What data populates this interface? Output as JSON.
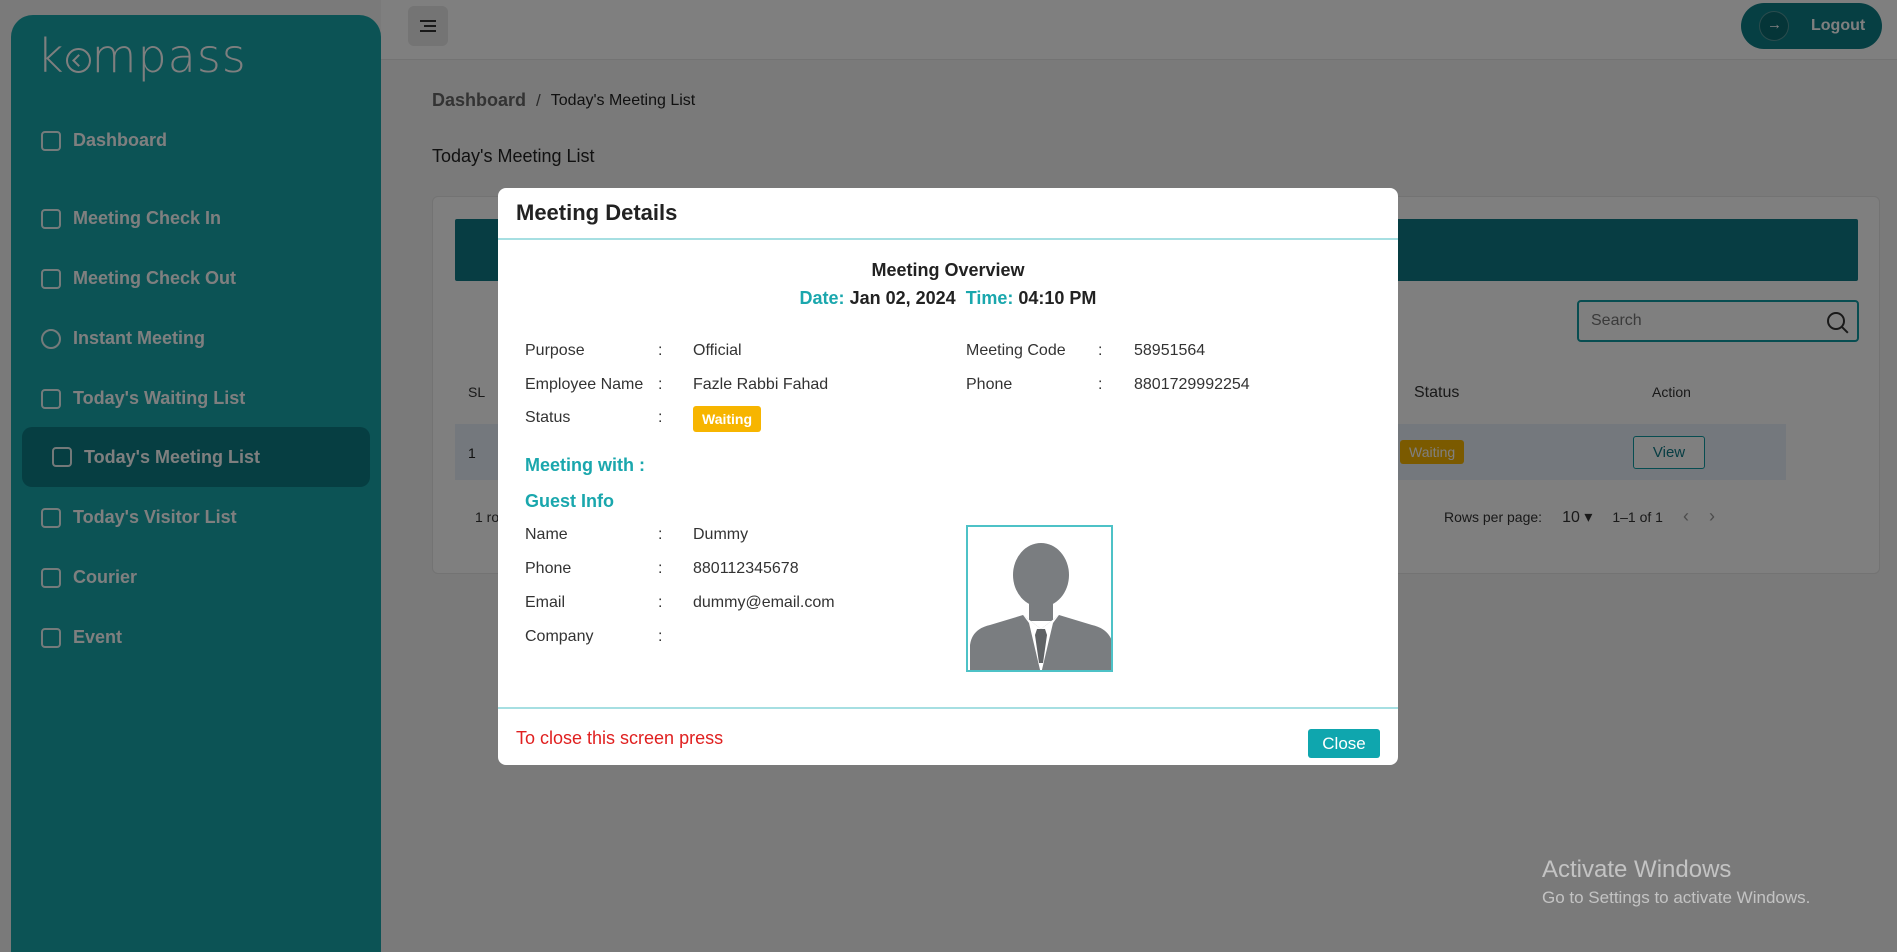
{
  "app": {
    "logo_prefix": "k",
    "logo_suffix": "mpass"
  },
  "sidebar": {
    "items": [
      {
        "label": "Dashboard",
        "icon": "chart-icon"
      },
      {
        "label": "Meeting Check In",
        "icon": "clipboard-icon"
      },
      {
        "label": "Meeting Check Out",
        "icon": "exit-icon"
      },
      {
        "label": "Instant Meeting",
        "icon": "users-icon"
      },
      {
        "label": "Today's Waiting List",
        "icon": "calendar-clock-icon"
      },
      {
        "label": "Today's Meeting List",
        "icon": "clipboard-list-icon",
        "active": true
      },
      {
        "label": "Today's Visitor List",
        "icon": "checklist-icon"
      },
      {
        "label": "Courier",
        "icon": "bag-icon"
      },
      {
        "label": "Event",
        "icon": "calendar-icon"
      }
    ]
  },
  "topbar": {
    "logout_label": "Logout"
  },
  "breadcrumb": {
    "home": "Dashboard",
    "separator": "/",
    "current": "Today's Meeting List"
  },
  "page": {
    "title": "Today's Meeting List"
  },
  "table": {
    "search_placeholder": "Search",
    "headers": {
      "sl": "SL",
      "status": "Status",
      "action": "Action"
    },
    "rows": [
      {
        "sl": "1",
        "status": "Waiting",
        "action": "View"
      }
    ],
    "footer_rows": "1 ro",
    "rows_per_page_label": "Rows per page:",
    "rows_per_page_value": "10",
    "range": "1–1 of 1"
  },
  "modal": {
    "title": "Meeting Details",
    "overview_title": "Meeting Overview",
    "date_label": "Date:",
    "date_value": "Jan 02, 2024",
    "time_label": "Time:",
    "time_value": "04:10 PM",
    "colon": ":",
    "purpose_label": "Purpose",
    "purpose_value": "Official",
    "employee_label": "Employee Name",
    "employee_value": "Fazle Rabbi Fahad",
    "status_label": "Status",
    "status_value": "Waiting",
    "code_label": "Meeting Code",
    "code_value": "58951564",
    "phone_label": "Phone",
    "phone_value": "8801729992254",
    "meeting_with": "Meeting with :",
    "guest_info": "Guest Info",
    "guest": {
      "name_label": "Name",
      "name_value": "Dummy",
      "phone_label": "Phone",
      "phone_value": "880112345678",
      "email_label": "Email",
      "email_value": "dummy@email.com",
      "company_label": "Company",
      "company_value": ""
    },
    "close_hint": "To close this screen press",
    "close_label": "Close"
  },
  "watermark": {
    "line1": "Activate Windows",
    "line2": "Go to Settings to activate Windows."
  },
  "colors": {
    "teal": "#18a6ab",
    "teal_dark": "#0c7d84",
    "badge": "#f7b500",
    "accent_text": "#1aa7ad",
    "hint_red": "#e02020"
  }
}
